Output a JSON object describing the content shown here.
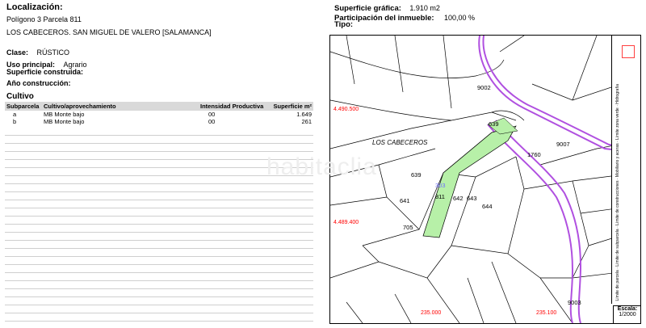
{
  "localizacion": {
    "label": "Localización:",
    "line1": "Polígono 3 Parcela 811",
    "line2": "LOS CABECEROS. SAN MIGUEL DE VALERO [SALAMANCA]"
  },
  "clase": {
    "label": "Clase:",
    "value": "RÚSTICO"
  },
  "uso": {
    "label": "Uso principal:",
    "value": "Agrario"
  },
  "superficie_construida": {
    "label": "Superficie construida:"
  },
  "anio": {
    "label": "Año construcción:"
  },
  "top_right": {
    "sup_label": "Superficie gráfica:",
    "sup_value": "1.910 m2",
    "part_label": "Participación del inmueble:",
    "part_value": "100,00 %",
    "tipo_label": "Tipo:"
  },
  "cultivo": {
    "title": "Cultivo",
    "headers": [
      "Subparcela",
      "Cultivo/aprovechamiento",
      "Intensidad Productiva",
      "Superficie m²"
    ],
    "rows": [
      [
        "a",
        "MB Monte bajo",
        "00",
        "1.649"
      ],
      [
        "b",
        "MB Monte bajo",
        "00",
        "261"
      ]
    ]
  },
  "map": {
    "coord_y1": "4.490.500",
    "coord_y2": "4.489.400",
    "coord_x1": "235.000",
    "coord_x2": "235.100",
    "place": "LOS CABECEROS",
    "parcels": [
      "9002",
      "639",
      "1760",
      "9007",
      "639",
      "811",
      "642",
      "643",
      "644",
      "641",
      "705",
      "9003"
    ],
    "highlight_label": "303",
    "escala_label": "Escala:",
    "escala_value": "1/2000",
    "legend": [
      "Límite de parcela",
      "Límite de subparcela",
      "Límite de construcciones",
      "Mobiliario y aceras",
      "Límite zona verde",
      "Hidrografía"
    ],
    "colors": {
      "parcel_fill": "#b7f0a8",
      "road": "#b050e0",
      "coord": "#ff0000"
    }
  },
  "watermark": "habitaclia"
}
